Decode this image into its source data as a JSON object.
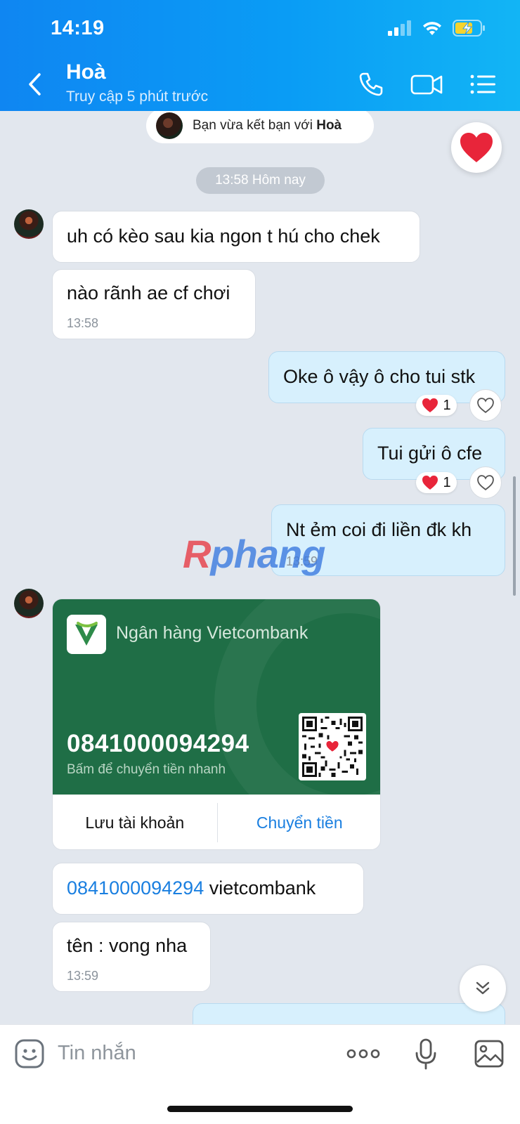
{
  "status_bar": {
    "time": "14:19"
  },
  "header": {
    "contact_name": "Hoà",
    "contact_status": "Truy cập 5 phút trước"
  },
  "friend_notice": {
    "prefix": "Bạn vừa kết bạn với ",
    "name": "Hoà"
  },
  "time_separator": "13:58 Hôm nay",
  "messages": [
    {
      "side": "in",
      "text": "uh có kèo sau kia ngon t hú cho chek"
    },
    {
      "side": "in",
      "text": "nào rãnh ae cf chơi",
      "time": "13:58"
    },
    {
      "side": "out",
      "text": "Oke ô vậy ô cho tui stk",
      "reaction_count": "1"
    },
    {
      "side": "out",
      "text": "Tui gửi ô cfe",
      "reaction_count": "1"
    },
    {
      "side": "out",
      "text": "Nt ẻm coi đi liền đk kh",
      "time": "13:59"
    },
    {
      "side": "in",
      "account_link": "0841000094294",
      "text": " vietcombank"
    },
    {
      "side": "in",
      "text": "tên : vong nha",
      "time": "13:59"
    }
  ],
  "bank_card": {
    "bank_name": "Ngân hàng Vietcombank",
    "account_number": "0841000094294",
    "hint": "Bấm để chuyển tiền nhanh",
    "save_label": "Lưu tài khoản",
    "transfer_label": "Chuyển tiền"
  },
  "watermark": {
    "part1": "R",
    "part2": "phang"
  },
  "input": {
    "placeholder": "Tin nhắn"
  },
  "colors": {
    "header_blue": "#0f86f2",
    "outgoing_bubble": "#d7f0fd",
    "bank_green": "#1f6e46",
    "link_blue": "#1a7fe0",
    "heart_red": "#e8253a"
  }
}
